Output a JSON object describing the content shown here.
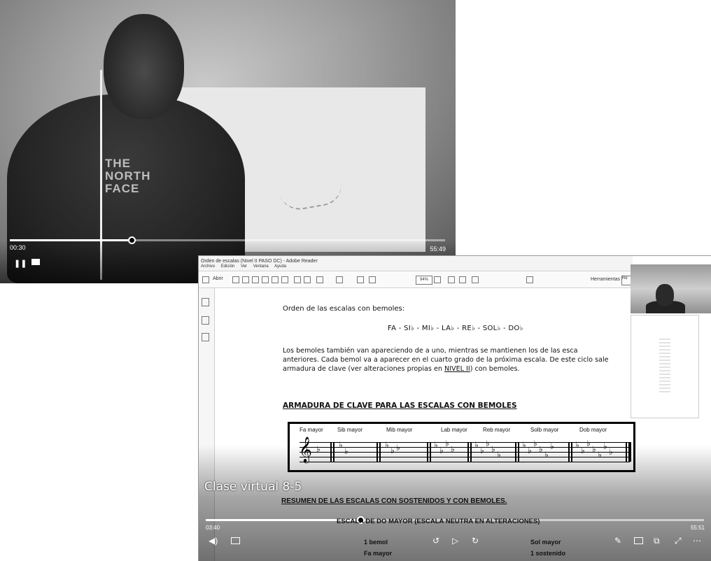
{
  "video_top": {
    "current_time": "00:30",
    "duration": "55:49",
    "progress": 0.28,
    "hoodie_logo": [
      "THE",
      "NORTH",
      "FACE"
    ]
  },
  "pdf_viewer": {
    "window_title": "Orden de escalas (Nivel II PASO DC) - Adobe Reader",
    "menu": [
      "Archivo",
      "Edición",
      "Ver",
      "Ventana",
      "Ayuda"
    ],
    "toolbar": {
      "open_label": "Abrir",
      "zoom": "94%",
      "tools_label": "Herramientas",
      "comment_label": "Re"
    },
    "document": {
      "intro": "Orden de las escalas con bemoles:",
      "order": "FA - SI♭ - MI♭ - LA♭ - RE♭ - SOL♭ - DO♭",
      "paragraph_1": "Los bemoles también van apareciendo de a uno, mientras se mantienen los de las esca",
      "paragraph_2": "anteriores. Cada bemol va a aparecer en el cuarto grado de la próxima escala. De este ciclo sale",
      "paragraph_3a": "armadura de clave (ver alteraciones propias en ",
      "paragraph_3_link": "NIVEL II",
      "paragraph_3b": ") con bemoles.",
      "heading": "ARMADURA DE CLAVE PARA LAS ESCALAS CON BEMOLES",
      "key_signatures": [
        "Fa mayor",
        "Sib mayor",
        "Mib mayor",
        "Lab mayor",
        "Reb mayor",
        "Solb mayor",
        "Dob mayor"
      ]
    }
  },
  "video_bottom": {
    "title": "Clase virtual 8-5",
    "current_time": "03:40",
    "duration": "55:51",
    "progress": 0.31,
    "summary_heading": "RESUMEN DE LAS ESCALAS CON SOSTENIDOS Y CON BEMOLES.",
    "escala_heading": "ESCALA DE DO MAYOR (ESCALA NEUTRA EN ALTERACIONES)",
    "col1_line1": "1 bemol",
    "col1_line2": "Fa mayor",
    "col2_line1": "Sol mayor",
    "col2_line2": "1 sostenido"
  }
}
